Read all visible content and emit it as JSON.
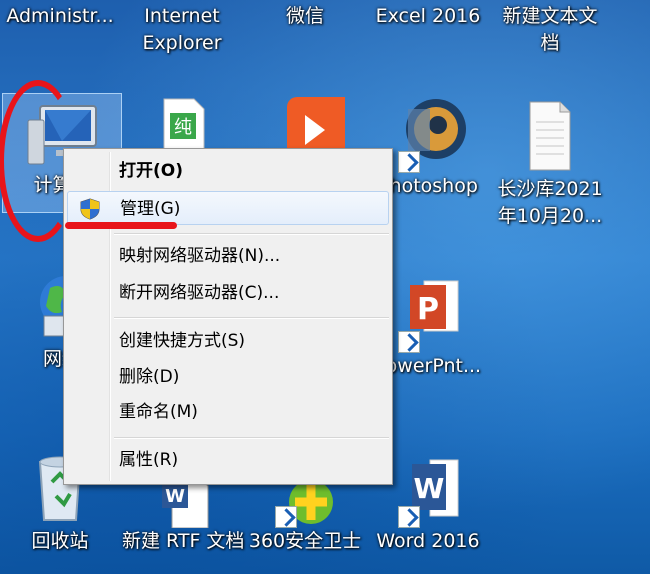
{
  "desktop": {
    "top_row": [
      {
        "label": "Administr...",
        "icon": "administrator-folder-icon"
      },
      {
        "label": "Internet Explorer",
        "icon": "internet-explorer-icon"
      },
      {
        "label": "微信",
        "icon": "wechat-icon"
      },
      {
        "label": "Excel 2016",
        "icon": "excel-icon"
      },
      {
        "label": "新建文本文档",
        "icon": "text-document-icon"
      }
    ],
    "computer": {
      "label": "计算机",
      "icon": "computer-icon"
    },
    "green_doc": {
      "glyph": "纯",
      "icon": "green-document-icon"
    },
    "photoshop": {
      "label": "Photoshop",
      "icon": "photoshop-icon"
    },
    "changsha": {
      "label": "长沙库2021年10月20...",
      "icon": "text-document-icon"
    },
    "network": {
      "label": "网络",
      "icon": "network-globe-icon"
    },
    "powerpoint": {
      "label": "PowerPnt...",
      "icon": "powerpoint-icon"
    },
    "bottom_row": [
      {
        "label": "回收站",
        "icon": "recycle-bin-icon"
      },
      {
        "label": "新建 RTF 文档",
        "icon": "rtf-document-icon"
      },
      {
        "label": "360安全卫士",
        "icon": "360-security-icon"
      },
      {
        "label": "Word 2016",
        "icon": "word-icon"
      }
    ]
  },
  "context_menu": {
    "items": [
      {
        "label": "打开(O)",
        "bold": true
      },
      {
        "label": "管理(G)",
        "icon": "uac-shield-icon",
        "highlighted": true
      },
      {
        "label": "映射网络驱动器(N)..."
      },
      {
        "label": "断开网络驱动器(C)..."
      },
      {
        "label": "创建快捷方式(S)"
      },
      {
        "label": "删除(D)"
      },
      {
        "label": "重命名(M)"
      },
      {
        "label": "属性(R)"
      }
    ]
  },
  "annotations": {
    "color": "#e8141a"
  }
}
